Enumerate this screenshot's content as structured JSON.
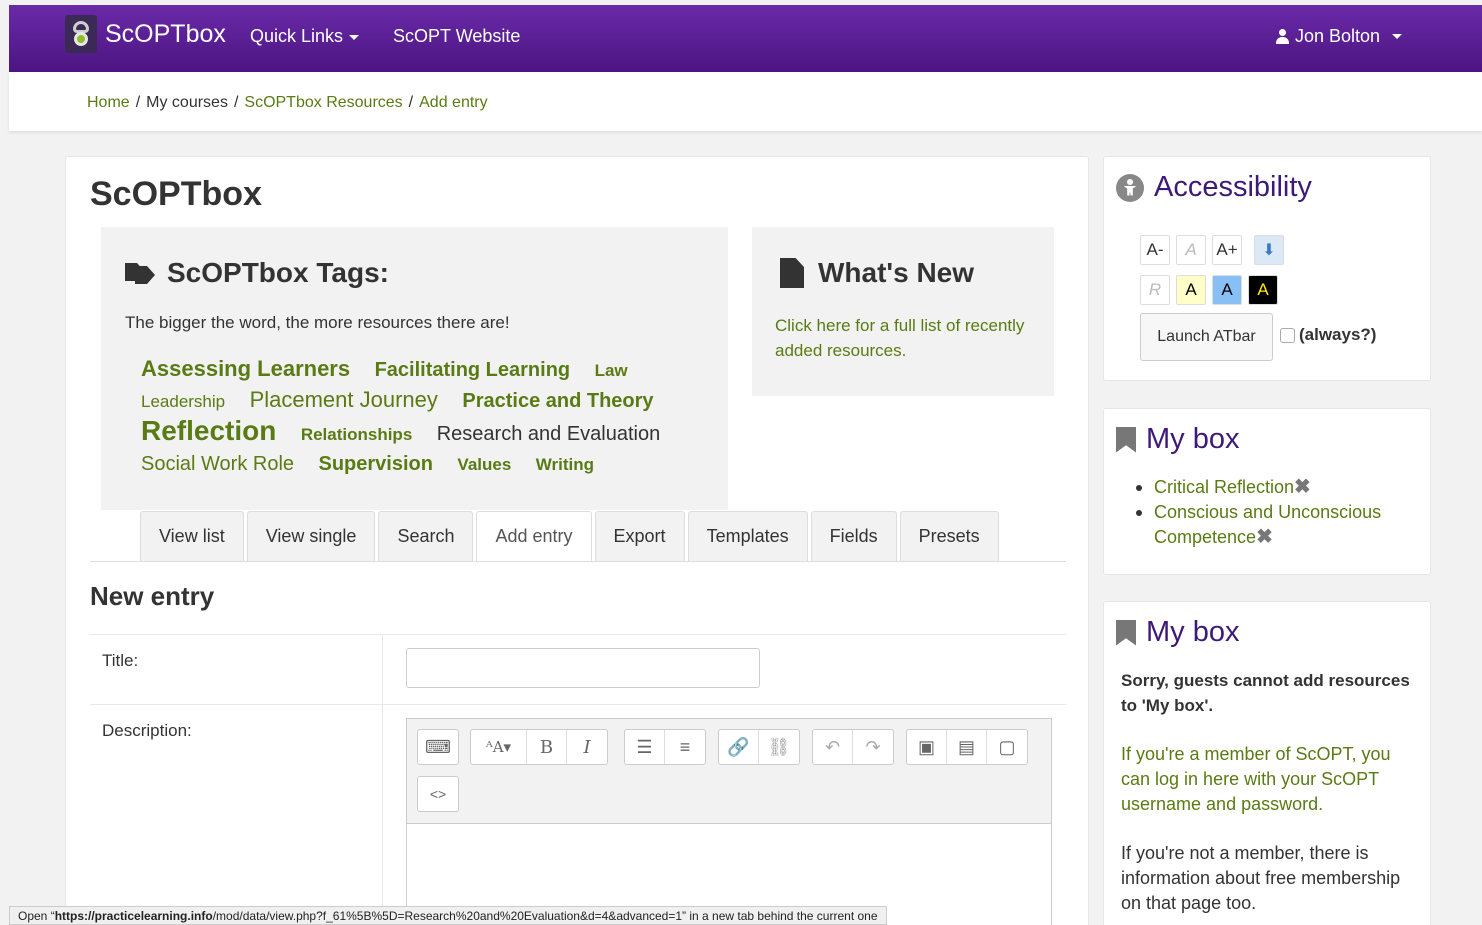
{
  "navbar": {
    "brand": "ScOPTbox",
    "links": [
      "Quick Links",
      "ScOPT Website"
    ],
    "user": "Jon Bolton"
  },
  "breadcrumb": {
    "home": "Home",
    "my_courses": "My courses",
    "resources": "ScOPTbox Resources",
    "add_entry": "Add entry",
    "separator": "/"
  },
  "main": {
    "title": "ScOPTbox",
    "tags": {
      "heading": "ScOPTbox Tags:",
      "intro": "The bigger the word, the more resources there are!",
      "cloud": [
        "Assessing Learners",
        "Facilitating Learning",
        "Law",
        "Leadership",
        "Placement Journey",
        "Practice and Theory",
        "Reflection",
        "Relationships",
        "Research and Evaluation",
        "Social Work Role",
        "Supervision",
        "Values",
        "Writing"
      ]
    },
    "whats_new": {
      "heading": "What's New",
      "link": "Click here for a full list of recently added resources."
    },
    "tabs": [
      "View list",
      "View single",
      "Search",
      "Add entry",
      "Export",
      "Templates",
      "Fields",
      "Presets"
    ],
    "active_tab": "Add entry",
    "form": {
      "heading": "New entry",
      "title_label": "Title:",
      "title_value": "",
      "description_label": "Description:"
    }
  },
  "accessibility": {
    "heading": "Accessibility",
    "buttons_row1": [
      "A-",
      "A",
      "A+"
    ],
    "buttons_row2": [
      "R",
      "A",
      "A",
      "A"
    ],
    "launch": "Launch ATbar",
    "always": "(always?)"
  },
  "mybox1": {
    "heading": "My box",
    "items": [
      "Critical Reflection",
      "Conscious and Unconscious Competence"
    ]
  },
  "mybox2": {
    "heading": "My box",
    "message": "Sorry, guests cannot add resources to 'My box'.",
    "member_link": "If you're a member of ScOPT, you can log in here with your ScOPT username and password.",
    "info": "If you're not a member, there is information about free membership on that page too."
  },
  "statusbar": {
    "text_prefix": "Open “",
    "url_host": "https://practicelearning.info",
    "url_path": "/mod/data/view.php?f_61%5B%5D=Research%20and%20Evaluation&d=4&advanced=1",
    "text_suffix": "” in a new tab behind the current one"
  },
  "colors": {
    "navbar_gradient_top": "#6a2aa8",
    "navbar_gradient_bottom": "#4b1581",
    "link_green": "#5a7b14",
    "heading_purple": "#3d1a78"
  }
}
